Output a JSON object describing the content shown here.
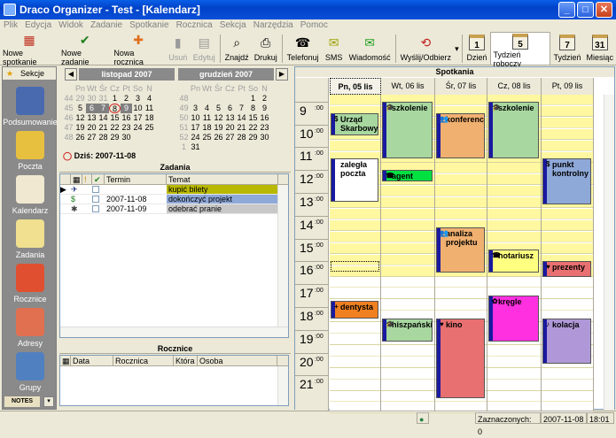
{
  "window": {
    "title": "Draco Organizer - Test - [Kalendarz]"
  },
  "menu": [
    "Plik",
    "Edycja",
    "Widok",
    "Zadanie",
    "Spotkanie",
    "Rocznica",
    "Sekcja",
    "Narzędzia",
    "Pomoc"
  ],
  "toolbar": {
    "nowe_spotkanie": "Nowe spotkanie",
    "nowe_zadanie": "Nowe zadanie",
    "nowa_rocznica": "Nowa rocznica",
    "usun": "Usuń",
    "edytuj": "Edytuj",
    "znajdz": "Znajdź",
    "drukuj": "Drukuj",
    "telefonuj": "Telefonuj",
    "sms": "SMS",
    "wiadomosc": "Wiadomość",
    "wyslij": "Wyślij/Odbierz",
    "dzien": "Dzień",
    "tydzien_roboczy": "Tydzień roboczy",
    "tydzien": "Tydzień",
    "miesiac": "Miesiąc",
    "cal_day": "1",
    "cal_workweek": "5",
    "cal_week": "7",
    "cal_month": "31"
  },
  "sidebar": {
    "header": "Sekcje",
    "items": [
      "Podsumowanie",
      "Poczta",
      "Kalendarz",
      "Zadania",
      "Rocznice",
      "Adresy",
      "Grupy"
    ],
    "notes": "NOTES"
  },
  "minical": {
    "left_title": "listopad 2007",
    "right_title": "grudzień 2007",
    "weekdays": [
      "Pn",
      "Wt",
      "Śr",
      "Cz",
      "Pt",
      "So",
      "N"
    ],
    "left_rows": [
      [
        "44",
        "29",
        "30",
        "31",
        "1",
        "2",
        "3",
        "4"
      ],
      [
        "45",
        "5",
        "6",
        "7",
        "8",
        "9",
        "10",
        "11"
      ],
      [
        "46",
        "12",
        "13",
        "14",
        "15",
        "16",
        "17",
        "18"
      ],
      [
        "47",
        "19",
        "20",
        "21",
        "22",
        "23",
        "24",
        "25"
      ],
      [
        "48",
        "26",
        "27",
        "28",
        "29",
        "30",
        "",
        ""
      ]
    ],
    "right_rows": [
      [
        "48",
        "",
        "",
        "",
        "",
        "",
        "1",
        "2"
      ],
      [
        "49",
        "3",
        "4",
        "5",
        "6",
        "7",
        "8",
        "9"
      ],
      [
        "50",
        "10",
        "11",
        "12",
        "13",
        "14",
        "15",
        "16"
      ],
      [
        "51",
        "17",
        "18",
        "19",
        "20",
        "21",
        "22",
        "23"
      ],
      [
        "52",
        "24",
        "25",
        "26",
        "27",
        "28",
        "29",
        "30"
      ],
      [
        "1",
        "31",
        "",
        "",
        "",
        "",
        "",
        ""
      ]
    ],
    "today_label": "Dziś: 2007-11-08"
  },
  "zadania": {
    "title": "Zadania",
    "columns": [
      "Termin",
      "Temat"
    ],
    "rows": [
      {
        "termin": "",
        "temat": "kupić bilety",
        "color": "#b8b800"
      },
      {
        "termin": "2007-11-08",
        "temat": "dokończyć projekt",
        "color": "#8ea8d8"
      },
      {
        "termin": "2007-11-09",
        "temat": "odebrać pranie",
        "color": "#c8c8c8"
      }
    ]
  },
  "rocznice": {
    "title": "Rocznice",
    "columns": [
      "Data",
      "Rocznica",
      "Która",
      "Osoba"
    ]
  },
  "calendar": {
    "title": "Spotkania",
    "days": [
      "Pn, 05 lis",
      "Wt, 06 lis",
      "Śr, 07 lis",
      "Cz, 08 lis",
      "Pt, 09 lis"
    ],
    "hours": [
      "9",
      "10",
      "11",
      "12",
      "13",
      "14",
      "15",
      "16",
      "17",
      "18",
      "19",
      "20",
      "21"
    ],
    "minutes": ":00",
    "events": [
      {
        "day": 0,
        "start": 9.5,
        "end": 10.5,
        "title": "Urząd Skarbowy",
        "color": "#a8d8a0",
        "icon": "$"
      },
      {
        "day": 0,
        "start": 11.5,
        "end": 13.4,
        "title": "zaległa poczta",
        "color": "#ffffff",
        "icon": ""
      },
      {
        "day": 0,
        "start": 17.75,
        "end": 18.5,
        "title": "dentysta",
        "color": "#f08020",
        "icon": "+"
      },
      {
        "day": 1,
        "start": 9,
        "end": 11.5,
        "title": "szkolenie",
        "color": "#a8d8a0",
        "icon": "🎓"
      },
      {
        "day": 1,
        "start": 12,
        "end": 12.5,
        "title": "agent",
        "color": "#00e040",
        "icon": "☎"
      },
      {
        "day": 1,
        "start": 18.5,
        "end": 19.5,
        "title": "hiszpański",
        "color": "#a8d8a0",
        "icon": "🎓"
      },
      {
        "day": 2,
        "start": 9.5,
        "end": 11.5,
        "title": "konferencja",
        "color": "#f0b070",
        "icon": "👥"
      },
      {
        "day": 2,
        "start": 14.5,
        "end": 16.5,
        "title": "analiza projektu",
        "color": "#f0b070",
        "icon": "👥"
      },
      {
        "day": 2,
        "start": 18.5,
        "end": 22,
        "title": "kino",
        "color": "#e87070",
        "icon": "♥"
      },
      {
        "day": 3,
        "start": 9,
        "end": 11.5,
        "title": "szkolenie",
        "color": "#a8d8a0",
        "icon": "🎓"
      },
      {
        "day": 3,
        "start": 15.5,
        "end": 16.5,
        "title": "notariusz",
        "color": "#ffff80",
        "icon": "☎"
      },
      {
        "day": 3,
        "start": 17.5,
        "end": 19.5,
        "title": "kręgle",
        "color": "#ff30e0",
        "icon": "✿"
      },
      {
        "day": 4,
        "start": 11.5,
        "end": 13.5,
        "title": "punkt kontrolny",
        "color": "#8ea8d8",
        "icon": "$"
      },
      {
        "day": 4,
        "start": 16,
        "end": 16.7,
        "title": "prezenty",
        "color": "#e87070",
        "icon": "♥"
      },
      {
        "day": 4,
        "start": 18.5,
        "end": 20.5,
        "title": "kolacja",
        "color": "#b098d8",
        "icon": "♪"
      }
    ]
  },
  "status": {
    "selected": "Zaznaczonych: 0",
    "date": "2007-11-08",
    "time": "18:01"
  }
}
